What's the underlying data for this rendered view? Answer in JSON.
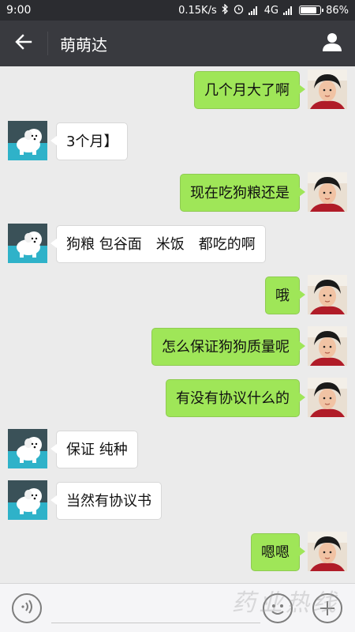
{
  "status_bar": {
    "time": "9:00",
    "speed": "0.15K/s",
    "network": "4G",
    "battery": "86%",
    "battery_level": 0.86
  },
  "header": {
    "title": "萌萌达",
    "back_icon": "arrow-left-icon",
    "profile_icon": "person-icon"
  },
  "messages": [
    {
      "side": "right",
      "text": "几个月大了啊"
    },
    {
      "side": "left",
      "text": "3个月】"
    },
    {
      "side": "right",
      "text": "现在吃狗粮还是"
    },
    {
      "side": "left",
      "text": "狗粮 包谷面　米饭　都吃的啊"
    },
    {
      "side": "right",
      "text": "哦"
    },
    {
      "side": "right",
      "text": "怎么保证狗狗质量呢"
    },
    {
      "side": "right",
      "text": "有没有协议什么的"
    },
    {
      "side": "left",
      "text": "保证 纯种"
    },
    {
      "side": "left",
      "text": "当然有协议书"
    },
    {
      "side": "right",
      "text": "嗯嗯"
    }
  ],
  "input_bar": {
    "input_value": "",
    "voice_icon": "voice-icon",
    "emoji_icon": "emoji-icon",
    "plus_icon": "plus-icon"
  },
  "watermark": "药业热线",
  "colors": {
    "sent_bubble": "#9fe658",
    "received_bubble": "#ffffff",
    "header_bg": "#393a3f",
    "chat_bg": "#ebebeb"
  }
}
